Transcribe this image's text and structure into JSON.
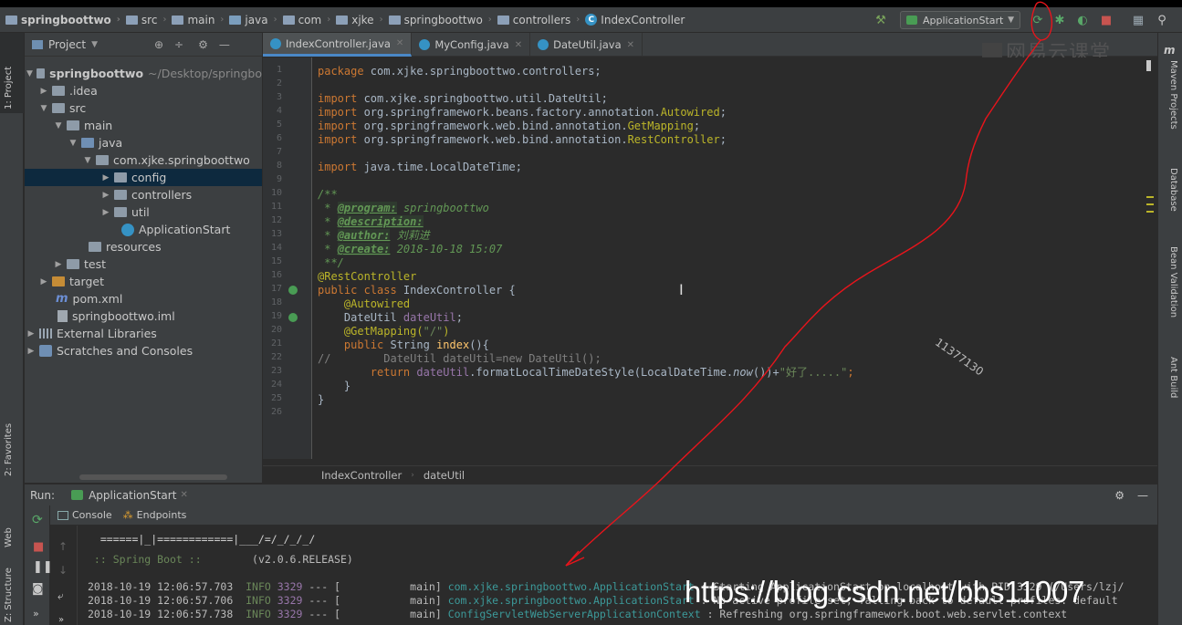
{
  "navbar": {
    "crumbs": [
      "springboottwo",
      "src",
      "main",
      "java",
      "com",
      "xjke",
      "springboottwo",
      "controllers",
      "IndexController"
    ],
    "run_config": "ApplicationStart"
  },
  "left_strip": {
    "project": "1: Project",
    "favorites": "2: Favorites",
    "web": "Web",
    "structure": "Z: Structure"
  },
  "right_strip": {
    "maven": "Maven Projects",
    "database": "Database",
    "bean": "Bean Validation",
    "ant": "Ant Build"
  },
  "project_panel": {
    "title": "Project",
    "tree": [
      {
        "label": "springboottwo",
        "extra": "~/Desktop/springbo"
      },
      {
        "label": ".idea"
      },
      {
        "label": "src"
      },
      {
        "label": "main"
      },
      {
        "label": "java"
      },
      {
        "label": "com.xjke.springboottwo"
      },
      {
        "label": "config"
      },
      {
        "label": "controllers"
      },
      {
        "label": "util"
      },
      {
        "label": "ApplicationStart"
      },
      {
        "label": "resources"
      },
      {
        "label": "test"
      },
      {
        "label": "target"
      },
      {
        "label": "pom.xml"
      },
      {
        "label": "springboottwo.iml"
      },
      {
        "label": "External Libraries"
      },
      {
        "label": "Scratches and Consoles"
      }
    ]
  },
  "editor_tabs": [
    "IndexController.java",
    "MyConfig.java",
    "DateUtil.java"
  ],
  "watermark_logo": "网易云课堂",
  "line_numbers": [
    "1",
    "2",
    "3",
    "4",
    "5",
    "6",
    "7",
    "8",
    "9",
    "10",
    "11",
    "12",
    "13",
    "14",
    "15",
    "16",
    "17",
    "18",
    "19",
    "20",
    "21",
    "22",
    "23",
    "24",
    "25",
    "26"
  ],
  "code": {
    "l1a": "package ",
    "l1b": "com.xjke.springboottwo.controllers;",
    "imp": "import ",
    "l3": "com.xjke.springboottwo.util.DateUtil;",
    "l4a": "org.springframework.beans.factory.annotation.",
    "l4b": "Autowired",
    "l4c": ";",
    "l5a": "org.springframework.web.bind.annotation.",
    "l5b": "GetMapping",
    "l5c": ";",
    "l6a": "org.springframework.web.bind.annotation.",
    "l6b": "RestController",
    "l6c": ";",
    "l8": "java.time.LocalDateTime;",
    "l10": "/**",
    "l11a": " * ",
    "l11b": "@program:",
    "l11c": " springboottwo",
    "l12a": " * ",
    "l12b": "@description:",
    "l13a": " * ",
    "l13b": "@author:",
    "l13c": " 刘莉进",
    "l14a": " * ",
    "l14b": "@create:",
    "l14c": " 2018-10-18 15:07",
    "l15": " **/",
    "l16": "@RestController",
    "l17a": "public class ",
    "l17b": "IndexController {",
    "l18": "    @Autowired",
    "l19a": "    DateUtil ",
    "l19b": "dateUtil",
    "l19c": ";",
    "l20a": "    @GetMapping(",
    "l20b": "\"/\"",
    "l20c": ")",
    "l21a": "    public ",
    "l21b": "String ",
    "l21c": "index",
    "l21d": "(){",
    "l22a": "//",
    "l22b": "        DateUtil dateUtil=new DateUtil();",
    "l23a": "        return ",
    "l23b": "dateUtil",
    "l23c": ".formatLocalTimeDateStyle(LocalDateTime.",
    "l23d": "now",
    "l23e": "())+",
    "l23f": "\"好了.....\"",
    "l23g": ";",
    "l24": "    }",
    "l25": "}"
  },
  "editor_breadcrumb": [
    "IndexController",
    "dateUtil"
  ],
  "run_panel": {
    "label": "Run:",
    "tab": "ApplicationStart",
    "console_tab": "Console",
    "endpoints_tab": "Endpoints"
  },
  "console": {
    "ascii1": "  ======|_|============|___/=/_/_/_/",
    "banner_a": " :: Spring Boot ::        ",
    "banner_b": "(v2.0.6.RELEASE)",
    "lines": [
      {
        "ts": "2018-10-19 12:06:57.703",
        "lvl": "INFO",
        "pid": "3329",
        "mid": " --- [           main] ",
        "logger": "com.xjke.springboottwo.ApplicationStart",
        "msg": " : Starting ApplicationStart on localhost with PID 3329 (/Users/lzj/"
      },
      {
        "ts": "2018-10-19 12:06:57.706",
        "lvl": "INFO",
        "pid": "3329",
        "mid": " --- [           main] ",
        "logger": "com.xjke.springboottwo.ApplicationStart",
        "msg": " : No active profile set, falling back to default profiles: default"
      },
      {
        "ts": "2018-10-19 12:06:57.738",
        "lvl": "INFO",
        "pid": "3329",
        "mid": " --- [           main] ",
        "logger": "ConfigServletWebServerApplicationContext",
        "msg": " : Refreshing org.springframework.boot.web.servlet.context"
      }
    ]
  },
  "overlay": {
    "watermark_url": "https://blog.csdn.net/bbs11007",
    "handwritten_number": "11377130",
    "colors": {
      "annotation": "#e8141b"
    }
  }
}
